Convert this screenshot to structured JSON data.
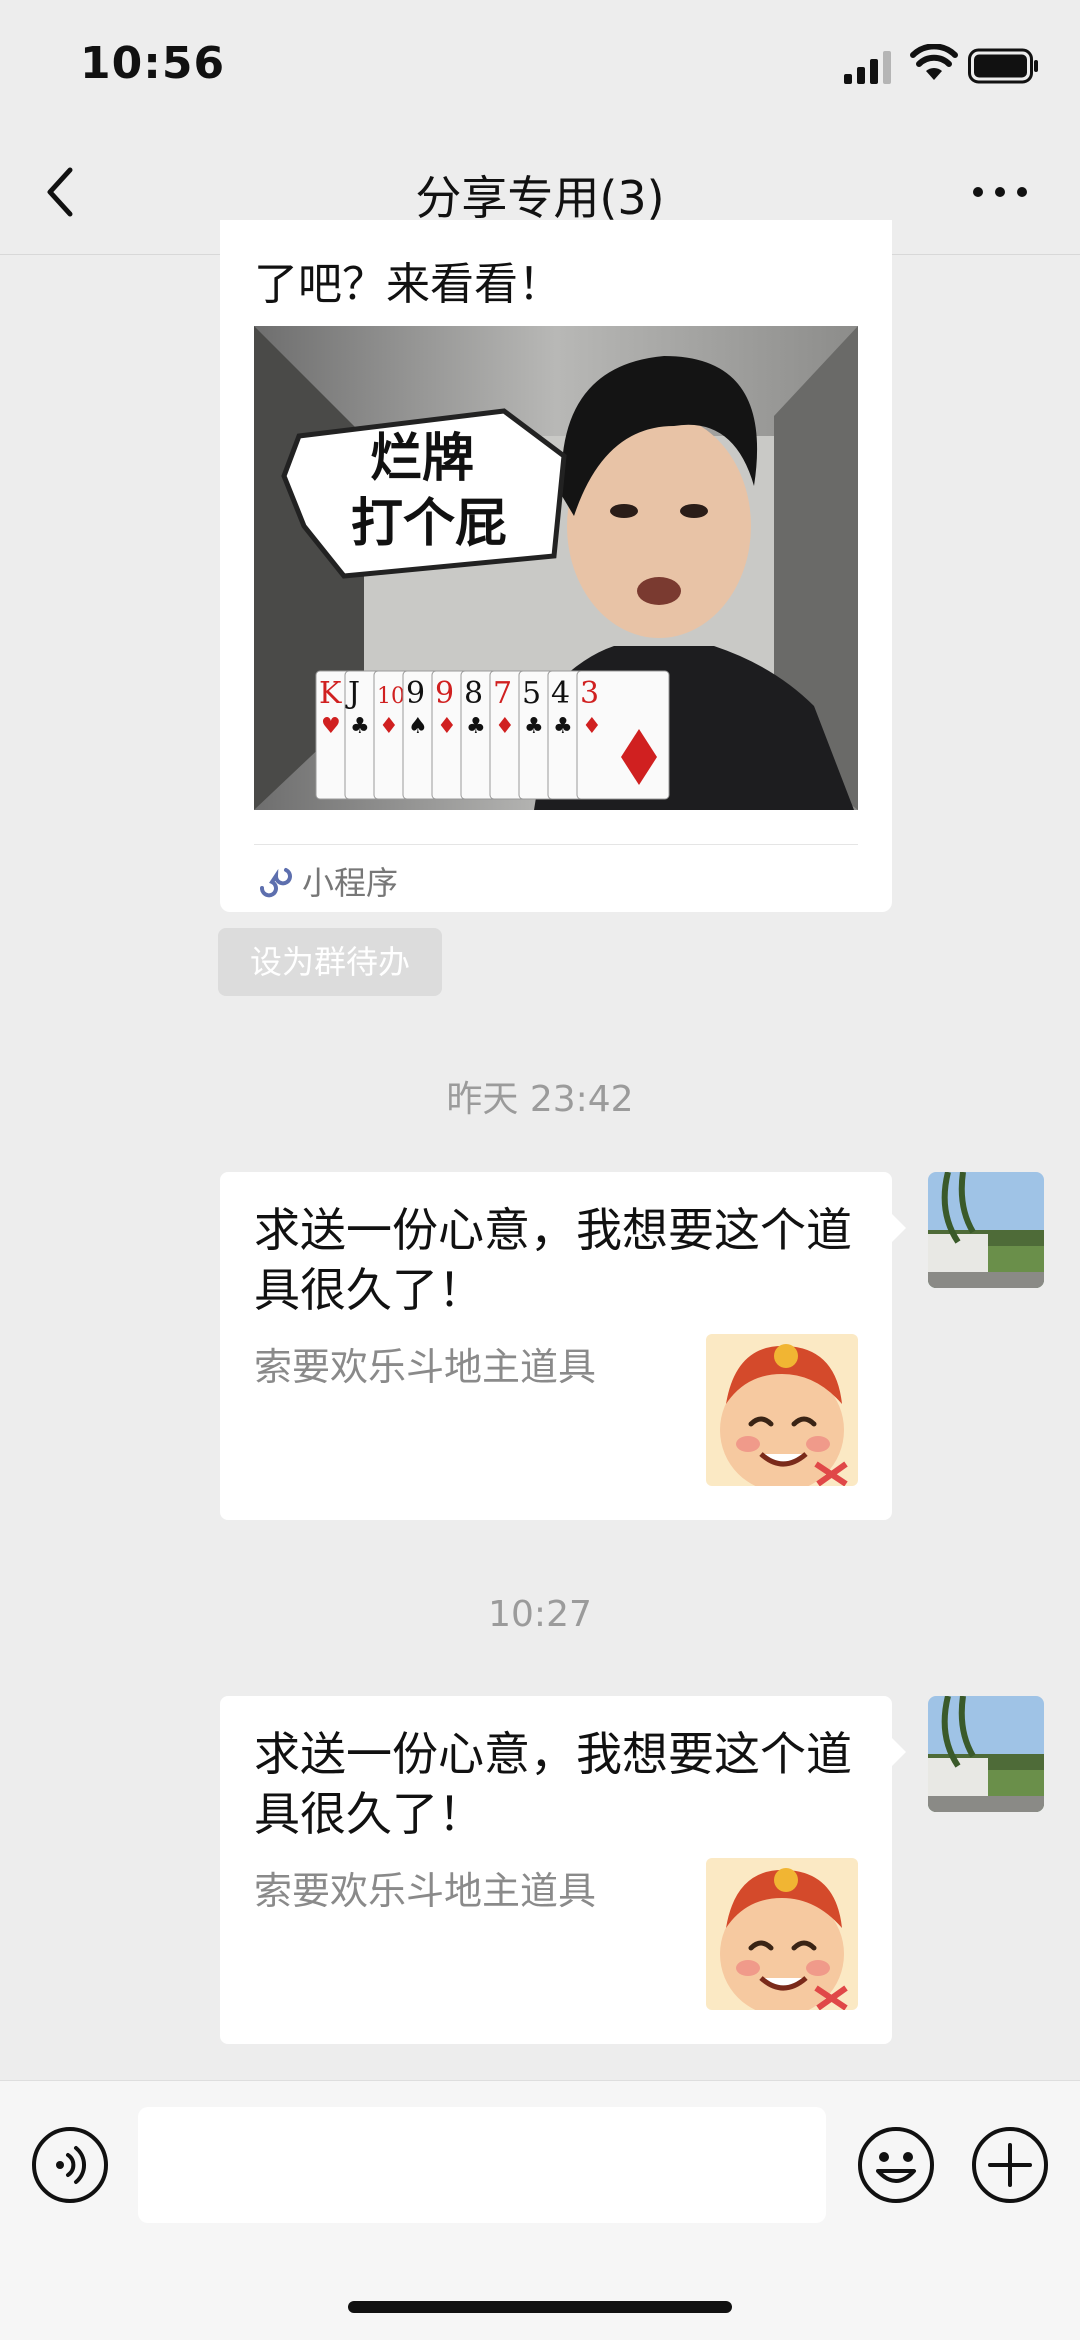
{
  "status_bar": {
    "time": "10:56"
  },
  "nav": {
    "title": "分享专用(3)"
  },
  "messages": {
    "mini_program": {
      "title_tail": "了吧？来看看！",
      "cover_text_line1": "烂牌",
      "cover_text_line2": "打个屁",
      "cards": [
        "K",
        "J",
        "10",
        "9",
        "9",
        "8",
        "7",
        "5",
        "4",
        "3"
      ],
      "source_label": "小程序"
    },
    "todo_button": "设为群待办",
    "timestamp1": "昨天 23:42",
    "gift1": {
      "title": "求送一份心意，我想要这个道具很久了！",
      "subtitle": "索要欢乐斗地主道具"
    },
    "timestamp2": "10:27",
    "gift2": {
      "title": "求送一份心意，我想要这个道具很久了！",
      "subtitle": "索要欢乐斗地主道具"
    }
  },
  "input_bar": {
    "placeholder": ""
  },
  "colors": {
    "background": "#ededed",
    "card": "#ffffff",
    "timestamp": "#9b9b9b",
    "todo_button": "#dcdcdc"
  }
}
